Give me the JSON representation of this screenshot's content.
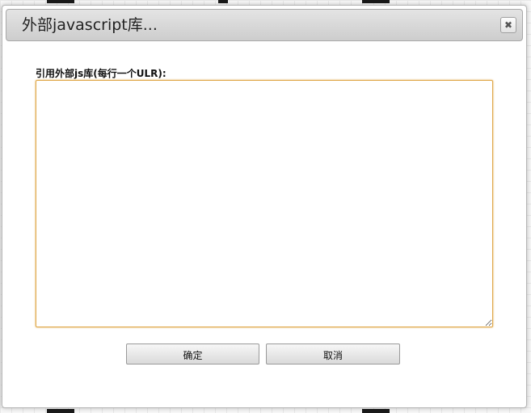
{
  "dialog": {
    "title": "外部javascript库...",
    "close_icon": "close-icon",
    "close_glyph": "✖",
    "field_label": "引用外部js库(每行一个ULR):",
    "textarea_value": "",
    "textarea_placeholder": "",
    "ok_label": "确定",
    "cancel_label": "取消"
  },
  "colors": {
    "textarea_focus_border": "#e0a84a",
    "titlebar_gradient_top": "#e4e4e4",
    "titlebar_gradient_bottom": "#cdcdcd"
  }
}
